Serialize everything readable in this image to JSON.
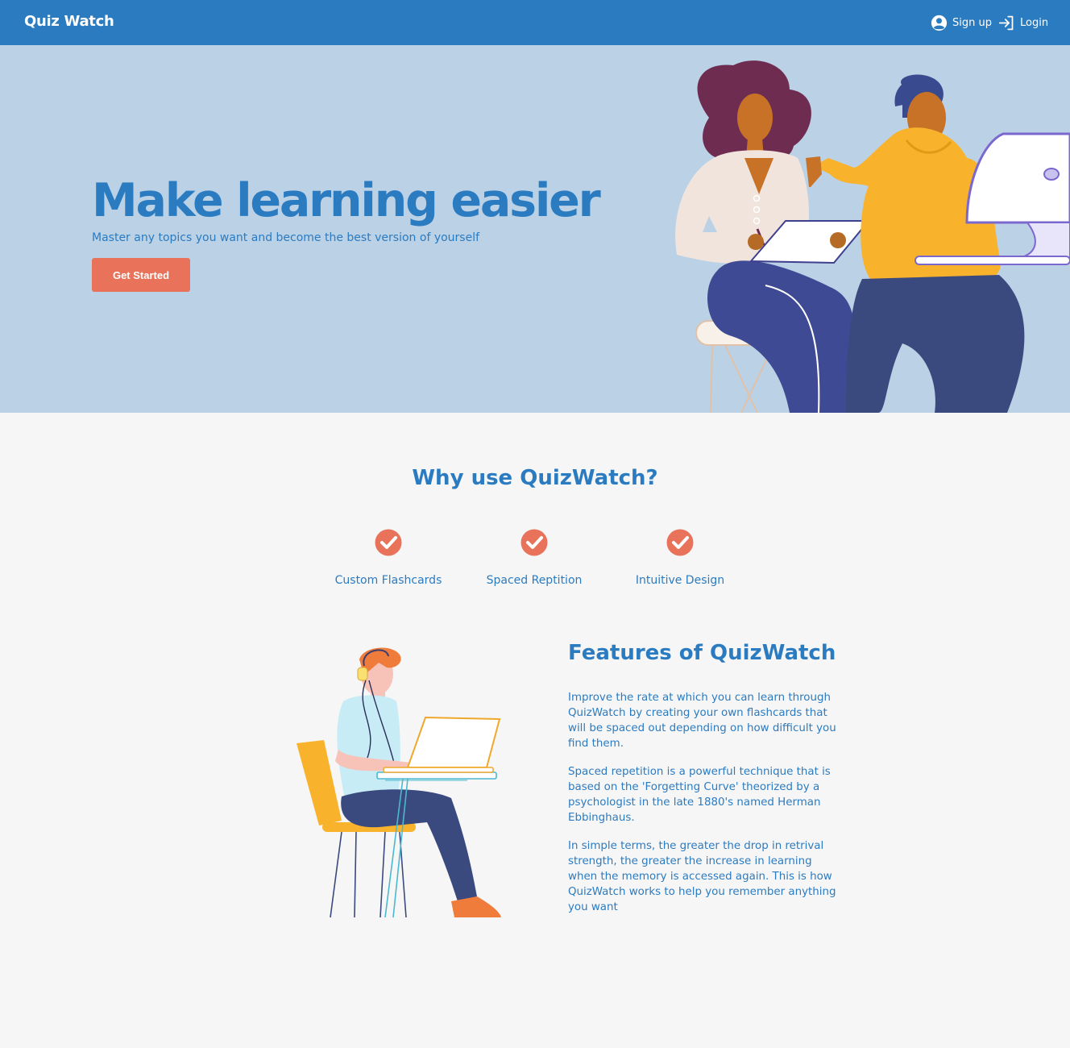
{
  "nav": {
    "brand": "Quiz Watch",
    "signup_label": "Sign up",
    "login_label": "Login",
    "signup_icon": "account-circle-icon",
    "login_icon": "login-arrow-icon"
  },
  "hero": {
    "title": "Make learning easier",
    "subtitle": "Master any topics you want and become the best version of yourself",
    "cta_label": "Get Started"
  },
  "why": {
    "title": "Why use QuizWatch?",
    "items": [
      {
        "label": "Custom Flashcards",
        "icon": "check-circle-icon"
      },
      {
        "label": "Spaced Reptition",
        "icon": "check-circle-icon"
      },
      {
        "label": "Intuitive Design",
        "icon": "check-circle-icon"
      }
    ]
  },
  "features": {
    "title": "Features of QuizWatch",
    "paragraphs": [
      "Improve the rate at which you can learn through QuizWatch by creating your own flashcards that will be spaced out depending on how difficult you find them.",
      "Spaced repetition is a powerful technique that is based on the 'Forgetting Curve' theorized by a psychologist in the late 1880's named Herman Ebbinghaus.",
      "In simple terms, the greater the drop in retrival strength, the greater the increase in learning when the memory is accessed again. This is how QuizWatch works to help you remember anything you want"
    ]
  },
  "colors": {
    "primary": "#2b7bc1",
    "hero_bg": "#bad1e6",
    "accent": "#e8735a",
    "page_bg": "#f6f6f6"
  }
}
